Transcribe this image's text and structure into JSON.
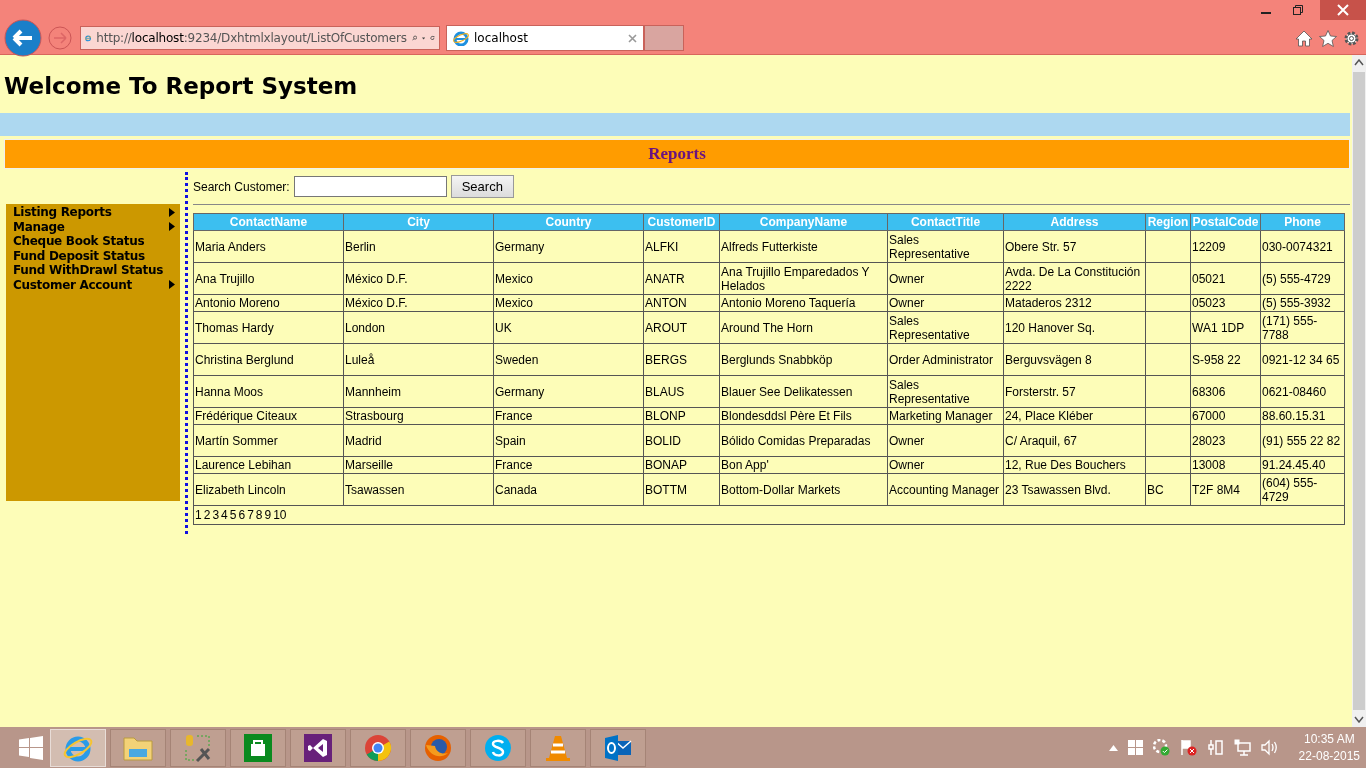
{
  "browser": {
    "address": "http://**localhost**:9234/Dxhtmlxlayout/ListOfCustomers",
    "tab": {
      "label": "localhost",
      "selected": true
    }
  },
  "page": {
    "title": "Welcome To Report System",
    "band_title": "Reports"
  },
  "sidebar": {
    "items": [
      {
        "label": "Listing Reports",
        "has_submenu": true
      },
      {
        "label": "Manage",
        "has_submenu": true
      },
      {
        "label": "Cheque Book Status",
        "has_submenu": false
      },
      {
        "label": "Fund Deposit Status",
        "has_submenu": false
      },
      {
        "label": "Fund WithDrawl Status",
        "has_submenu": false
      },
      {
        "label": "Customer Account",
        "has_submenu": true
      }
    ]
  },
  "search": {
    "label": "Search Customer:",
    "button": "Search"
  },
  "table": {
    "columns": [
      "ContactName",
      "City",
      "Country",
      "CustomerID",
      "CompanyName",
      "ContactTitle",
      "Address",
      "Region",
      "PostalCode",
      "Phone"
    ],
    "rows": [
      [
        "Maria Anders",
        "Berlin",
        "Germany",
        "ALFKI",
        "Alfreds Futterkiste",
        "Sales Representative",
        "Obere Str. 57",
        "",
        "12209",
        "030-0074321"
      ],
      [
        "Ana Trujillo",
        "México D.F.",
        "Mexico",
        "ANATR",
        "Ana Trujillo Emparedados Y Helados",
        "Owner",
        "Avda. De La Constitución 2222",
        "",
        "05021",
        "(5) 555-4729"
      ],
      [
        "Antonio Moreno",
        "México D.F.",
        "Mexico",
        "ANTON",
        "Antonio Moreno Taquería",
        "Owner",
        "Mataderos 2312",
        "",
        "05023",
        "(5) 555-3932"
      ],
      [
        "Thomas Hardy",
        "London",
        "UK",
        "AROUT",
        "Around The Horn",
        "Sales Representative",
        "120 Hanover Sq.",
        "",
        "WA1 1DP",
        "(171) 555-7788"
      ],
      [
        "Christina Berglund",
        "Luleå",
        "Sweden",
        "BERGS",
        "Berglunds Snabbköp",
        "Order Administrator",
        "Berguvsvägen 8",
        "",
        "S-958 22",
        "0921-12 34 65"
      ],
      [
        "Hanna Moos",
        "Mannheim",
        "Germany",
        "BLAUS",
        "Blauer See Delikatessen",
        "Sales Representative",
        "Forsterstr. 57",
        "",
        "68306",
        "0621-08460"
      ],
      [
        "Frédérique Citeaux",
        "Strasbourg",
        "France",
        "BLONP",
        "Blondesddsl Père Et Fils",
        "Marketing Manager",
        "24, Place Kléber",
        "",
        "67000",
        "88.60.15.31"
      ],
      [
        "Martín Sommer",
        "Madrid",
        "Spain",
        "BOLID",
        "Bólido Comidas Preparadas",
        "Owner",
        "C/ Araquil, 67",
        "",
        "28023",
        "(91) 555 22 82"
      ],
      [
        "Laurence Lebihan",
        "Marseille",
        "France",
        "BONAP",
        "Bon App'",
        "Owner",
        "12, Rue Des Bouchers",
        "",
        "13008",
        "91.24.45.40"
      ],
      [
        "Elizabeth Lincoln",
        "Tsawassen",
        "Canada",
        "BOTTM",
        "Bottom-Dollar Markets",
        "Accounting Manager",
        "23 Tsawassen Blvd.",
        "BC",
        "T2F 8M4",
        "(604) 555-4729"
      ]
    ],
    "pager": [
      "1",
      "2",
      "3",
      "4",
      "5",
      "6",
      "7",
      "8",
      "9",
      "10"
    ]
  },
  "taskbar": {
    "apps": [
      {
        "kind": "ie",
        "selected": true
      },
      {
        "kind": "explorer",
        "selected": false
      },
      {
        "kind": "tools",
        "selected": false
      },
      {
        "kind": "store",
        "selected": false
      },
      {
        "kind": "vs",
        "selected": false
      },
      {
        "kind": "chrome",
        "selected": false
      },
      {
        "kind": "firefox",
        "selected": false
      },
      {
        "kind": "skype",
        "selected": false
      },
      {
        "kind": "vlc",
        "selected": false
      },
      {
        "kind": "outlook",
        "selected": false
      }
    ],
    "time": "10:35 AM",
    "date": "22-08-2015"
  }
}
